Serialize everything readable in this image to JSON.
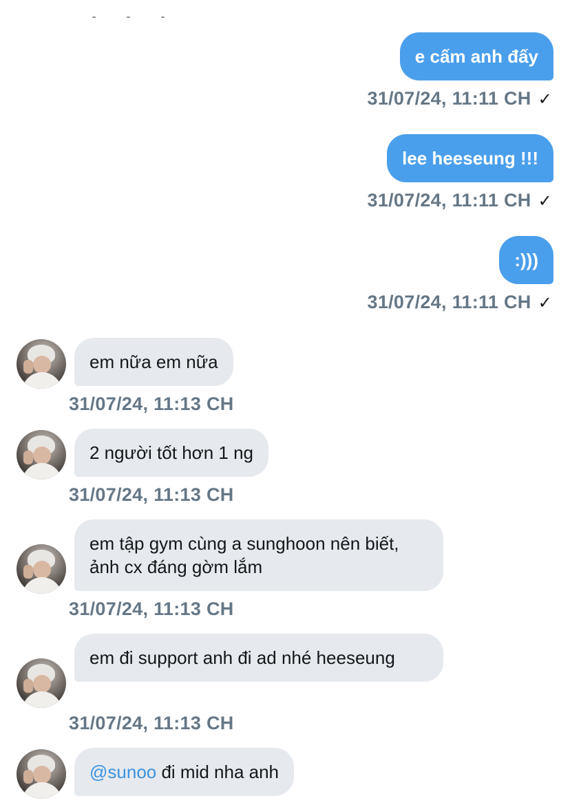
{
  "messages": [
    {
      "direction": "out",
      "text": "e cấm anh đấy",
      "time": "31/07/24, 11:11 CH",
      "status_icon": "✓"
    },
    {
      "direction": "out",
      "text": "lee heeseung !!!",
      "time": "31/07/24, 11:11 CH",
      "status_icon": "✓"
    },
    {
      "direction": "out",
      "text": ":)))",
      "time": "31/07/24, 11:11 CH",
      "status_icon": "✓"
    },
    {
      "direction": "in",
      "text": "em nữa em nữa",
      "time": "31/07/24, 11:13 CH"
    },
    {
      "direction": "in",
      "text": "2 người tốt hơn 1 ng",
      "time": "31/07/24, 11:13 CH"
    },
    {
      "direction": "in",
      "text": "em tập gym cùng a sunghoon nên biết, ảnh cx đáng gờm lắm",
      "time": "31/07/24, 11:13 CH"
    },
    {
      "direction": "in",
      "text": "em đi support anh đi ad nhé heeseung",
      "time": "31/07/24, 11:13 CH"
    },
    {
      "direction": "in",
      "mention": "@sunoo",
      "text": " đi mid nha anh"
    }
  ],
  "colors": {
    "outgoing_bubble": "#4a9fec",
    "incoming_bubble": "#e6e9ee",
    "timestamp": "#657786",
    "mention": "#3b93e0"
  },
  "icons": {
    "read_receipt": "checkmark-icon",
    "avatar": "user-avatar"
  }
}
